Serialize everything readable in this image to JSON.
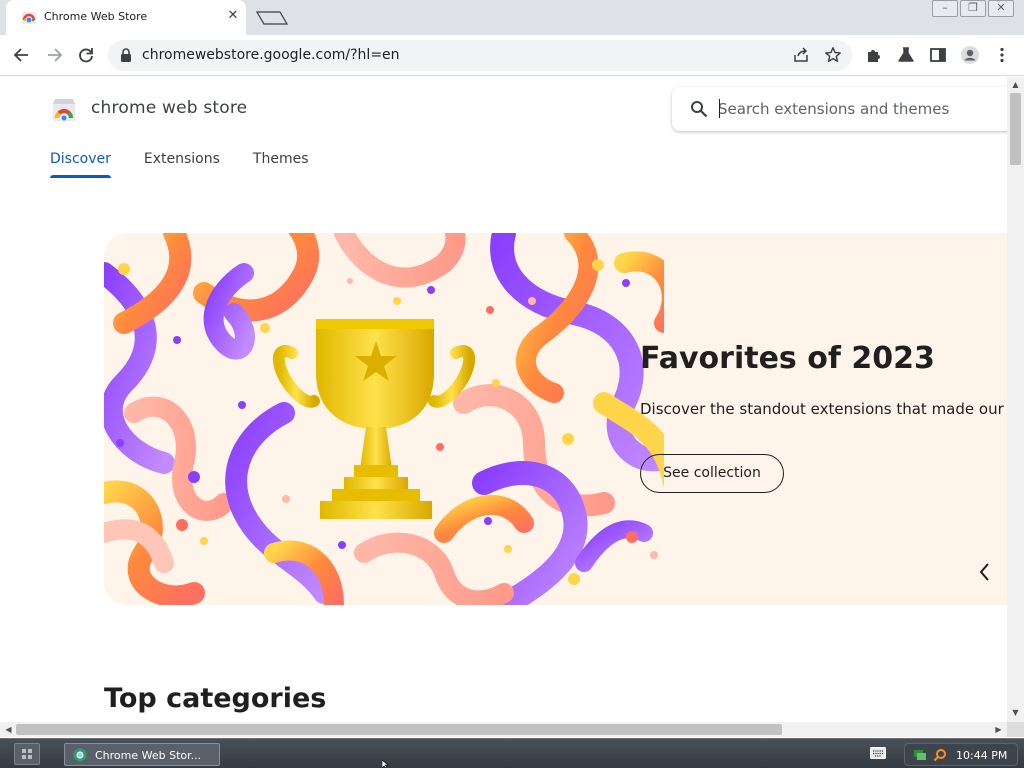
{
  "browser": {
    "tab_title": "Chrome Web Store",
    "tab_close": "✕",
    "url": "chromewebstore.google.com/?hl=en",
    "window_buttons": [
      "–",
      "❐",
      "✕"
    ]
  },
  "store": {
    "name": "chrome web store",
    "search_placeholder": "Search extensions and themes",
    "nav_tabs": [
      {
        "label": "Discover",
        "active": true
      },
      {
        "label": "Extensions",
        "active": false
      },
      {
        "label": "Themes",
        "active": false
      }
    ]
  },
  "hero": {
    "title": "Favorites of 2023",
    "subtitle": "Discover the standout extensions that made our year",
    "button_label": "See collection"
  },
  "sections": {
    "top_categories": "Top categories"
  },
  "taskbar": {
    "task_label": "Chrome Web Stor...",
    "clock": "10:44 PM"
  },
  "colors": {
    "accent": "#0b57d0",
    "hero_bg": "#fef4e9",
    "tabstrip": "#dee1e6"
  },
  "icons": {
    "back": "arrow-left-icon",
    "forward": "arrow-right-icon",
    "reload": "reload-icon",
    "lock": "lock-icon",
    "share": "share-icon",
    "bookmark": "star-icon",
    "extensions": "puzzle-icon",
    "labs": "flask-icon",
    "side_panel": "side-panel-icon",
    "profile": "avatar-icon",
    "menu": "kebab-menu-icon",
    "search": "search-icon"
  }
}
